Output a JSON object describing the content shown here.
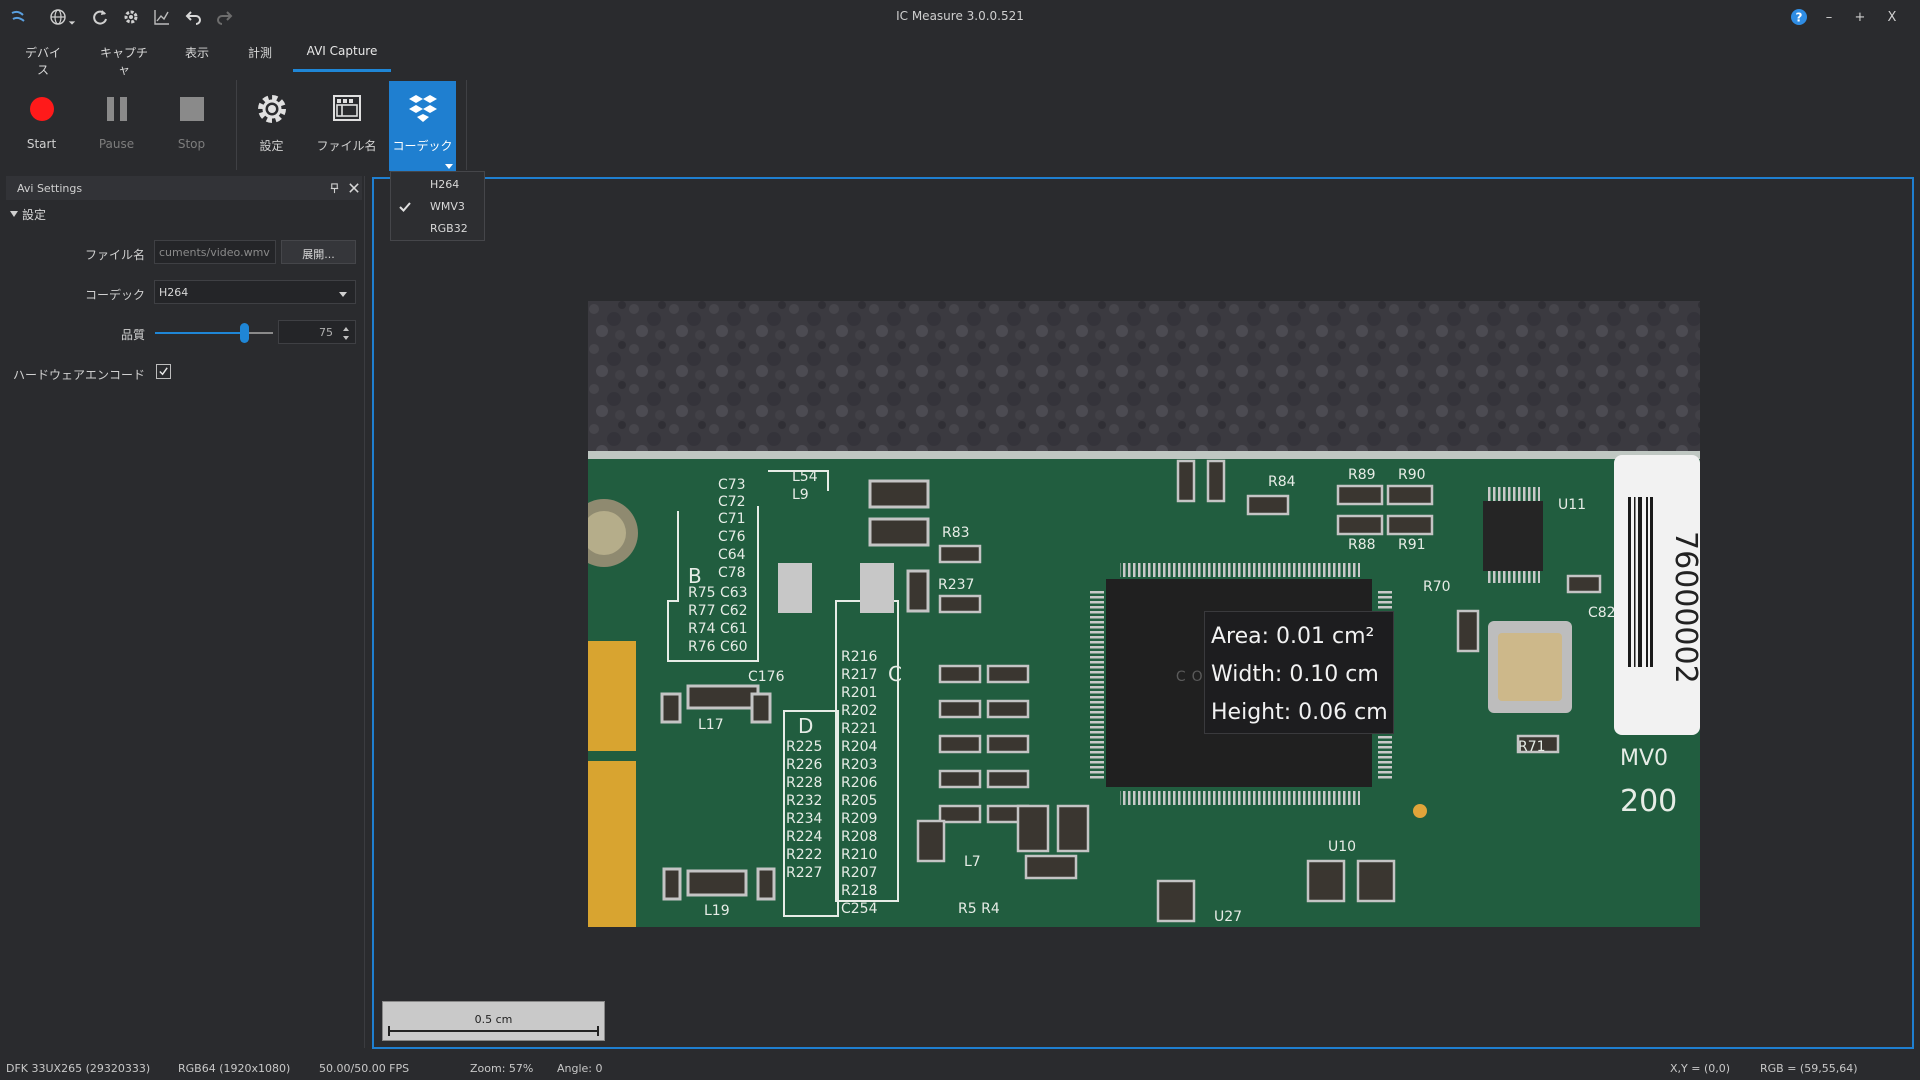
{
  "window": {
    "title": "IC Measure 3.0.0.521",
    "minimize_label": "–",
    "maximize_label": "+",
    "close_label": "X"
  },
  "quick_access": [
    "app-logo-icon",
    "globe-icon",
    "refresh-icon",
    "gear-icon",
    "chart-icon",
    "undo-icon",
    "redo-icon",
    "help-icon"
  ],
  "menu_tabs": [
    {
      "label": "デバイス",
      "active": false
    },
    {
      "label": "キャプチャ",
      "active": false
    },
    {
      "label": "表示",
      "active": false
    },
    {
      "label": "計測",
      "active": false
    },
    {
      "label": "AVI Capture",
      "active": true
    }
  ],
  "ribbon": {
    "start_label": "Start",
    "pause_label": "Pause",
    "stop_label": "Stop",
    "settings_label": "設定",
    "filename_label": "ファイル名",
    "codec_label": "コーデック"
  },
  "codec_menu": {
    "items": [
      {
        "label": "H264",
        "checked": false
      },
      {
        "label": "WMV3",
        "checked": true
      },
      {
        "label": "RGB32",
        "checked": false
      }
    ]
  },
  "panel": {
    "title": "Avi Settings",
    "section": "設定",
    "filename_label": "ファイル名",
    "filename_value": "cuments/video.wmv",
    "browse_label": "展開...",
    "codec_label": "コーデック",
    "codec_value": "H264",
    "quality_label": "品質",
    "quality_value": "75",
    "quality_fraction": 0.75,
    "hw_encode_label": "ハードウェアエンコード",
    "hw_encode_checked": true
  },
  "viewer": {
    "measure": {
      "area": "Area: 0.01 cm²",
      "width": "Width: 0.10 cm",
      "height": "Height: 0.06 cm"
    },
    "scale_label": "0.5 cm"
  },
  "status": {
    "device": "DFK 33UX265 (29320333)",
    "format": "RGB64 (1920x1080)",
    "fps": "50.00/50.00 FPS",
    "zoom": "Zoom: 57%",
    "angle": "Angle: 0",
    "xy": "X,Y = (0,0)",
    "rgb": "RGB = (59,55,64)"
  },
  "colors": {
    "accent": "#1f7fd0",
    "record": "#ff1a1a",
    "background": "#2a2b2e"
  }
}
